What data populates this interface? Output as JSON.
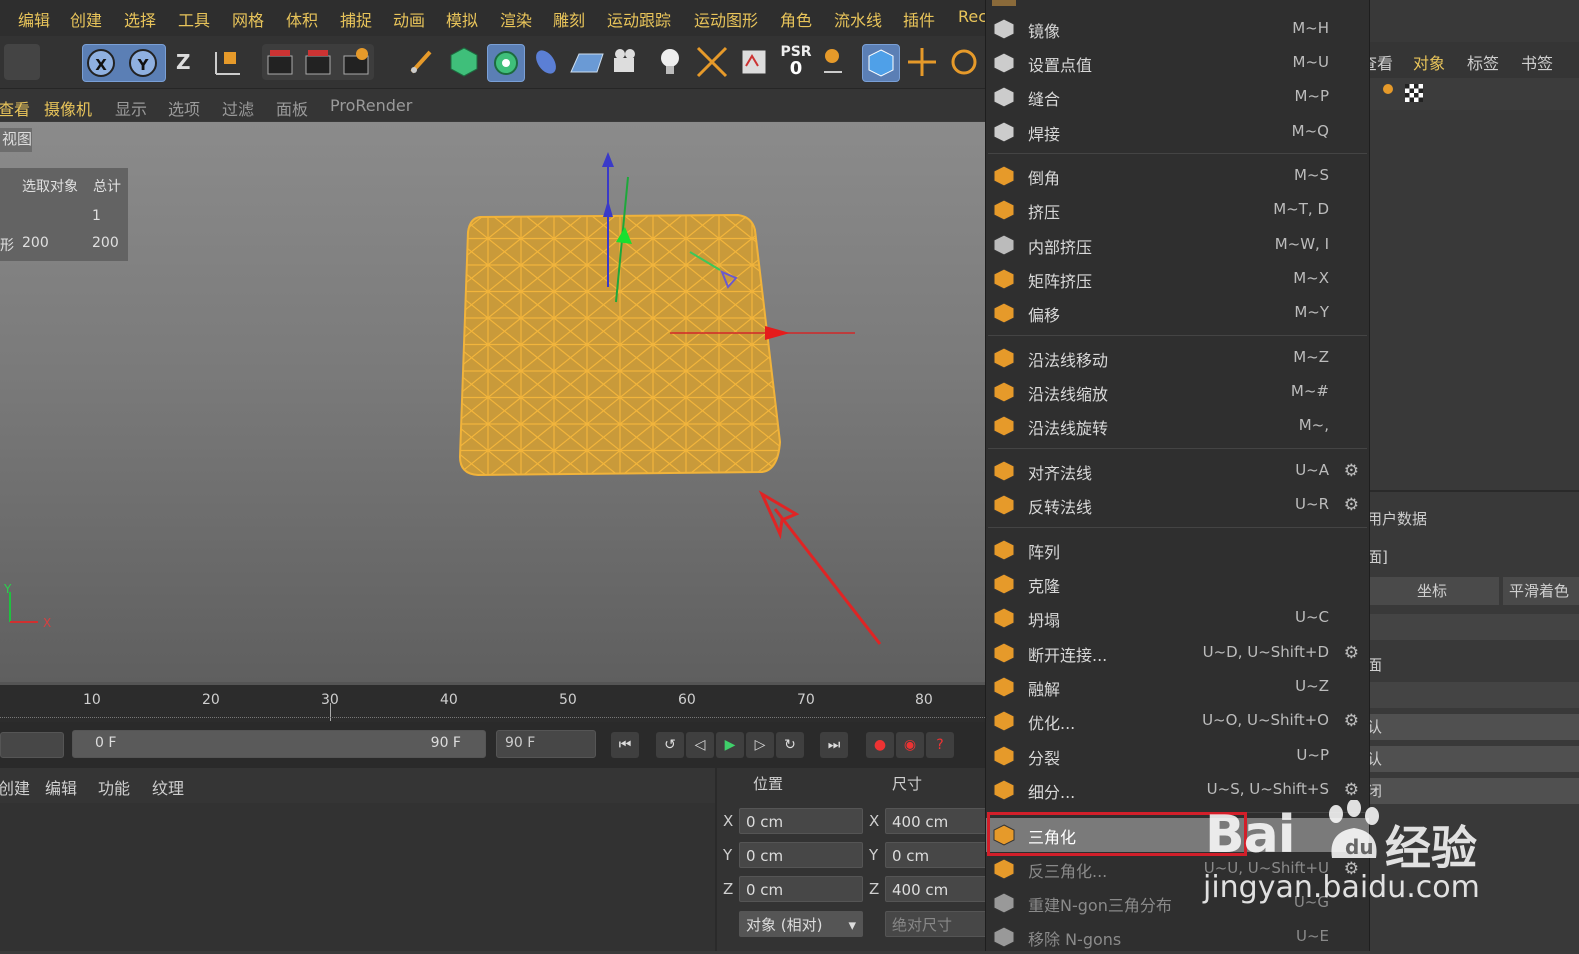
{
  "menubar": [
    "编辑",
    "创建",
    "选择",
    "工具",
    "网格",
    "体积",
    "捕捉",
    "动画",
    "模拟",
    "渲染",
    "雕刻",
    "运动跟踪",
    "运动图形",
    "角色",
    "流水线",
    "插件",
    "Rec"
  ],
  "toolbar": {
    "x_label": "X",
    "y_label": "Y",
    "z_label": "Z",
    "psr_label": "PSR",
    "psr_value": "0"
  },
  "viewport_menu": [
    "查看",
    "摄像机",
    "显示",
    "选项",
    "过滤",
    "面板",
    "ProRender"
  ],
  "view_tab": "视图",
  "stats": {
    "col1": "选取对象",
    "col2": "总计",
    "row1_val": "1",
    "row2_label": "形",
    "row2_a": "200",
    "row2_b": "200"
  },
  "axis": {
    "y": "Y",
    "x": "X"
  },
  "timeline": {
    "ticks": [
      "10",
      "20",
      "30",
      "40",
      "50",
      "60",
      "70",
      "80"
    ],
    "start_field": "0 F",
    "end_field": "90 F",
    "max_field": "90 F"
  },
  "material_menu": [
    "创建",
    "编辑",
    "功能",
    "纹理"
  ],
  "coords": {
    "pos_header": "位置",
    "size_header": "尺寸",
    "x_label": "X",
    "y_label": "Y",
    "z_label": "Z",
    "pos_x": "0 cm",
    "pos_y": "0 cm",
    "pos_z": "0 cm",
    "size_x": "400 cm",
    "size_y": "0 cm",
    "size_z": "400 cm",
    "mode_select": "对象 (相对)",
    "abs_button": "绝对尺寸"
  },
  "right_panel": {
    "tabs": [
      "查看",
      "对象",
      "标签",
      "书签"
    ],
    "user_data": "用户数据",
    "bracket_label": "面]",
    "btn_coords": "坐标",
    "btn_smooth": "平滑着色",
    "row_face": "面",
    "row_a": "认",
    "row_b": "认",
    "row_c": "闭"
  },
  "menu": {
    "items": [
      {
        "label": "镜像",
        "shortcut": "M~H"
      },
      {
        "label": "设置点值",
        "shortcut": "M~U"
      },
      {
        "label": "缝合",
        "shortcut": "M~P"
      },
      {
        "label": "焊接",
        "shortcut": "M~Q"
      },
      {
        "label": "倒角",
        "shortcut": "M~S"
      },
      {
        "label": "挤压",
        "shortcut": "M~T, D"
      },
      {
        "label": "内部挤压",
        "shortcut": "M~W, I"
      },
      {
        "label": "矩阵挤压",
        "shortcut": "M~X"
      },
      {
        "label": "偏移",
        "shortcut": "M~Y"
      },
      {
        "label": "沿法线移动",
        "shortcut": "M~Z"
      },
      {
        "label": "沿法线缩放",
        "shortcut": "M~#"
      },
      {
        "label": "沿法线旋转",
        "shortcut": "M~,"
      },
      {
        "label": "对齐法线",
        "shortcut": "U~A"
      },
      {
        "label": "反转法线",
        "shortcut": "U~R"
      },
      {
        "label": "阵列",
        "shortcut": ""
      },
      {
        "label": "克隆",
        "shortcut": ""
      },
      {
        "label": "坍塌",
        "shortcut": "U~C"
      },
      {
        "label": "断开连接...",
        "shortcut": "U~D, U~Shift+D"
      },
      {
        "label": "融解",
        "shortcut": "U~Z"
      },
      {
        "label": "优化...",
        "shortcut": "U~O, U~Shift+O"
      },
      {
        "label": "分裂",
        "shortcut": "U~P"
      },
      {
        "label": "细分...",
        "shortcut": "U~S, U~Shift+S"
      },
      {
        "label": "三角化",
        "shortcut": ""
      },
      {
        "label": "反三角化...",
        "shortcut": "U~U, U~Shift+U"
      },
      {
        "label": "重建N-gon三角分布",
        "shortcut": "U~G"
      },
      {
        "label": "移除 N-gons",
        "shortcut": "U~E"
      }
    ]
  },
  "watermark": {
    "brand": "Bai",
    "brand_cn": "经验",
    "url": "jingyan.baidu.com"
  },
  "colors": {
    "accent": "#e8c45a",
    "mesh_fill": "#c99a3a",
    "highlight_box": "#d21f2a"
  }
}
